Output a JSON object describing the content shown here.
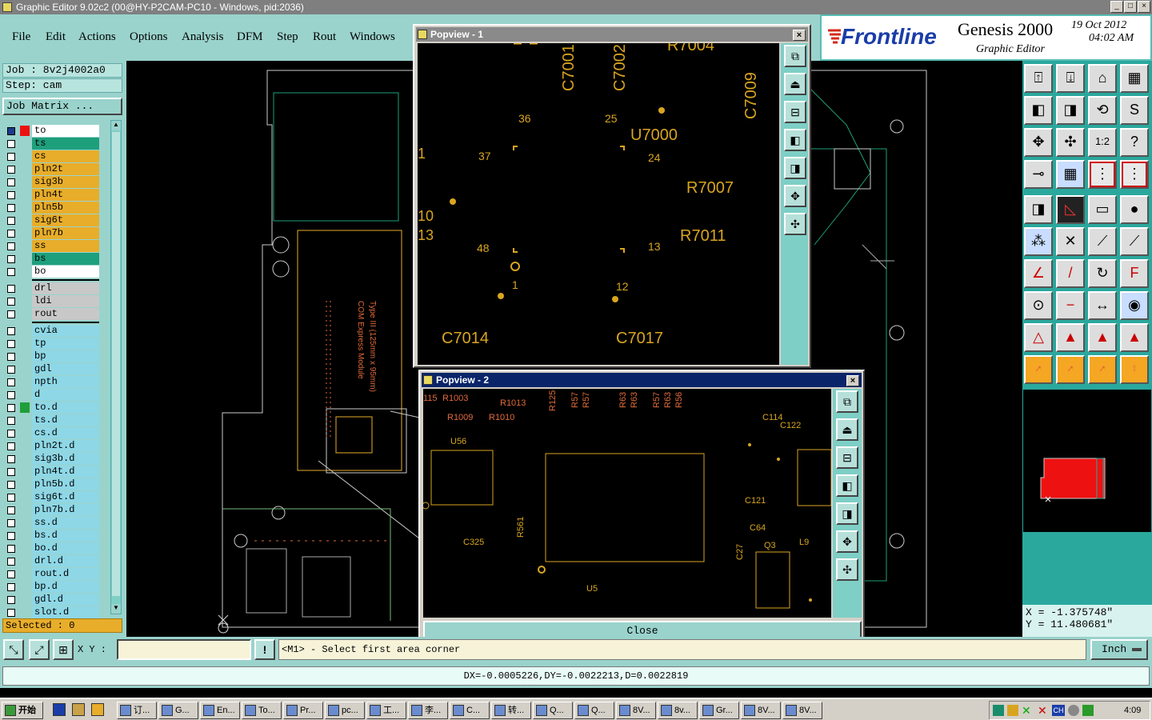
{
  "window": {
    "title": "Graphic Editor 9.02c2 (00@HY-P2CAM-PC10 - Windows, pid:2036)"
  },
  "menu": [
    "File",
    "Edit",
    "Actions",
    "Options",
    "Analysis",
    "DFM",
    "Step",
    "Rout",
    "Windows"
  ],
  "brand": {
    "logo": "Frontline",
    "product": "Genesis 2000",
    "subtitle": "Graphic Editor",
    "date": "19 Oct 2012",
    "time": "04:02 AM"
  },
  "job": {
    "job_label": "Job : 8v2j4002a0",
    "step_label": "Step: cam",
    "matrix_button": "Job Matrix ..."
  },
  "layers": {
    "board": [
      {
        "name": "to",
        "color": "#ffffff",
        "active": true
      },
      {
        "name": "ts",
        "color": "#1e9f7c"
      },
      {
        "name": "cs",
        "color": "#e8ad2a"
      },
      {
        "name": "pln2t",
        "color": "#e8ad2a"
      },
      {
        "name": "sig3b",
        "color": "#e8ad2a"
      },
      {
        "name": "pln4t",
        "color": "#e8ad2a"
      },
      {
        "name": "pln5b",
        "color": "#e8ad2a"
      },
      {
        "name": "sig6t",
        "color": "#e8ad2a"
      },
      {
        "name": "pln7b",
        "color": "#e8ad2a"
      },
      {
        "name": "ss",
        "color": "#e8ad2a"
      },
      {
        "name": "bs",
        "color": "#1e9f7c"
      },
      {
        "name": "bo",
        "color": "#ffffff"
      }
    ],
    "drill": [
      {
        "name": "drl",
        "color": "#c8c8c8"
      },
      {
        "name": "ldi",
        "color": "#c8c8c8"
      },
      {
        "name": "rout",
        "color": "#c8c8c8"
      }
    ],
    "misc": [
      {
        "name": "cvia",
        "color": "#8ed7e6"
      },
      {
        "name": "tp",
        "color": "#8ed7e6"
      },
      {
        "name": "bp",
        "color": "#8ed7e6"
      },
      {
        "name": "gdl",
        "color": "#8ed7e6"
      },
      {
        "name": "npth",
        "color": "#8ed7e6"
      },
      {
        "name": "d",
        "color": "#8ed7e6"
      },
      {
        "name": "to.d",
        "color": "#8ed7e6"
      },
      {
        "name": "ts.d",
        "color": "#8ed7e6"
      },
      {
        "name": "cs.d",
        "color": "#8ed7e6"
      },
      {
        "name": "pln2t.d",
        "color": "#8ed7e6"
      },
      {
        "name": "sig3b.d",
        "color": "#8ed7e6"
      },
      {
        "name": "pln4t.d",
        "color": "#8ed7e6"
      },
      {
        "name": "pln5b.d",
        "color": "#8ed7e6"
      },
      {
        "name": "sig6t.d",
        "color": "#8ed7e6"
      },
      {
        "name": "pln7b.d",
        "color": "#8ed7e6"
      },
      {
        "name": "ss.d",
        "color": "#8ed7e6"
      },
      {
        "name": "bs.d",
        "color": "#8ed7e6"
      },
      {
        "name": "bo.d",
        "color": "#8ed7e6"
      },
      {
        "name": "drl.d",
        "color": "#8ed7e6"
      },
      {
        "name": "rout.d",
        "color": "#8ed7e6"
      },
      {
        "name": "bp.d",
        "color": "#8ed7e6"
      },
      {
        "name": "gdl.d",
        "color": "#8ed7e6"
      },
      {
        "name": "slot.d",
        "color": "#8ed7e6"
      }
    ]
  },
  "selected": "Selected : 0",
  "popview1": {
    "title": "Popview - 1",
    "labels": [
      "C7001",
      "C7002",
      "R7004",
      "C7009",
      "36",
      "25",
      "U7000",
      "37",
      "24",
      "R7007",
      "10",
      "13",
      "R7011",
      "48",
      "13",
      "1",
      "12",
      "C7014",
      "C7017",
      "1"
    ]
  },
  "popview2": {
    "title": "Popview - 2",
    "close": "Close",
    "labels": [
      "R1003",
      "R1013",
      "R1009",
      "R1010",
      "U56",
      "C114",
      "C122",
      "C121",
      "C64",
      "C27",
      "Q3",
      "L9",
      "C325",
      "R561",
      "U5",
      "R57",
      "R57",
      "R63",
      "R63",
      "R57",
      "R56",
      "R63",
      "R125",
      "115"
    ]
  },
  "coords": {
    "x": "X = -1.375748\"",
    "y": "Y = 11.480681\""
  },
  "command": {
    "xy_label": "X Y :",
    "xy_value": "",
    "prompt": "<M1> - Select first area corner",
    "unit": "Inch"
  },
  "status": "DX=-0.0005226,DY=-0.0022213,D=0.0022819",
  "taskbar": {
    "start": "开始",
    "items": [
      "订...",
      "G...",
      "En...",
      "To...",
      "Pr...",
      "pc...",
      "工...",
      "李...",
      "C...",
      "转...",
      "Q...",
      "Q...",
      "8V...",
      "8v...",
      "Gr...",
      "8V...",
      "8V..."
    ],
    "clock": "4:09",
    "tray_lang": "CH"
  },
  "colors": {
    "panel": "#9ad3cc",
    "accent": "#2aa89e",
    "copper": "#d9a520",
    "silk": "#e06a3a"
  }
}
